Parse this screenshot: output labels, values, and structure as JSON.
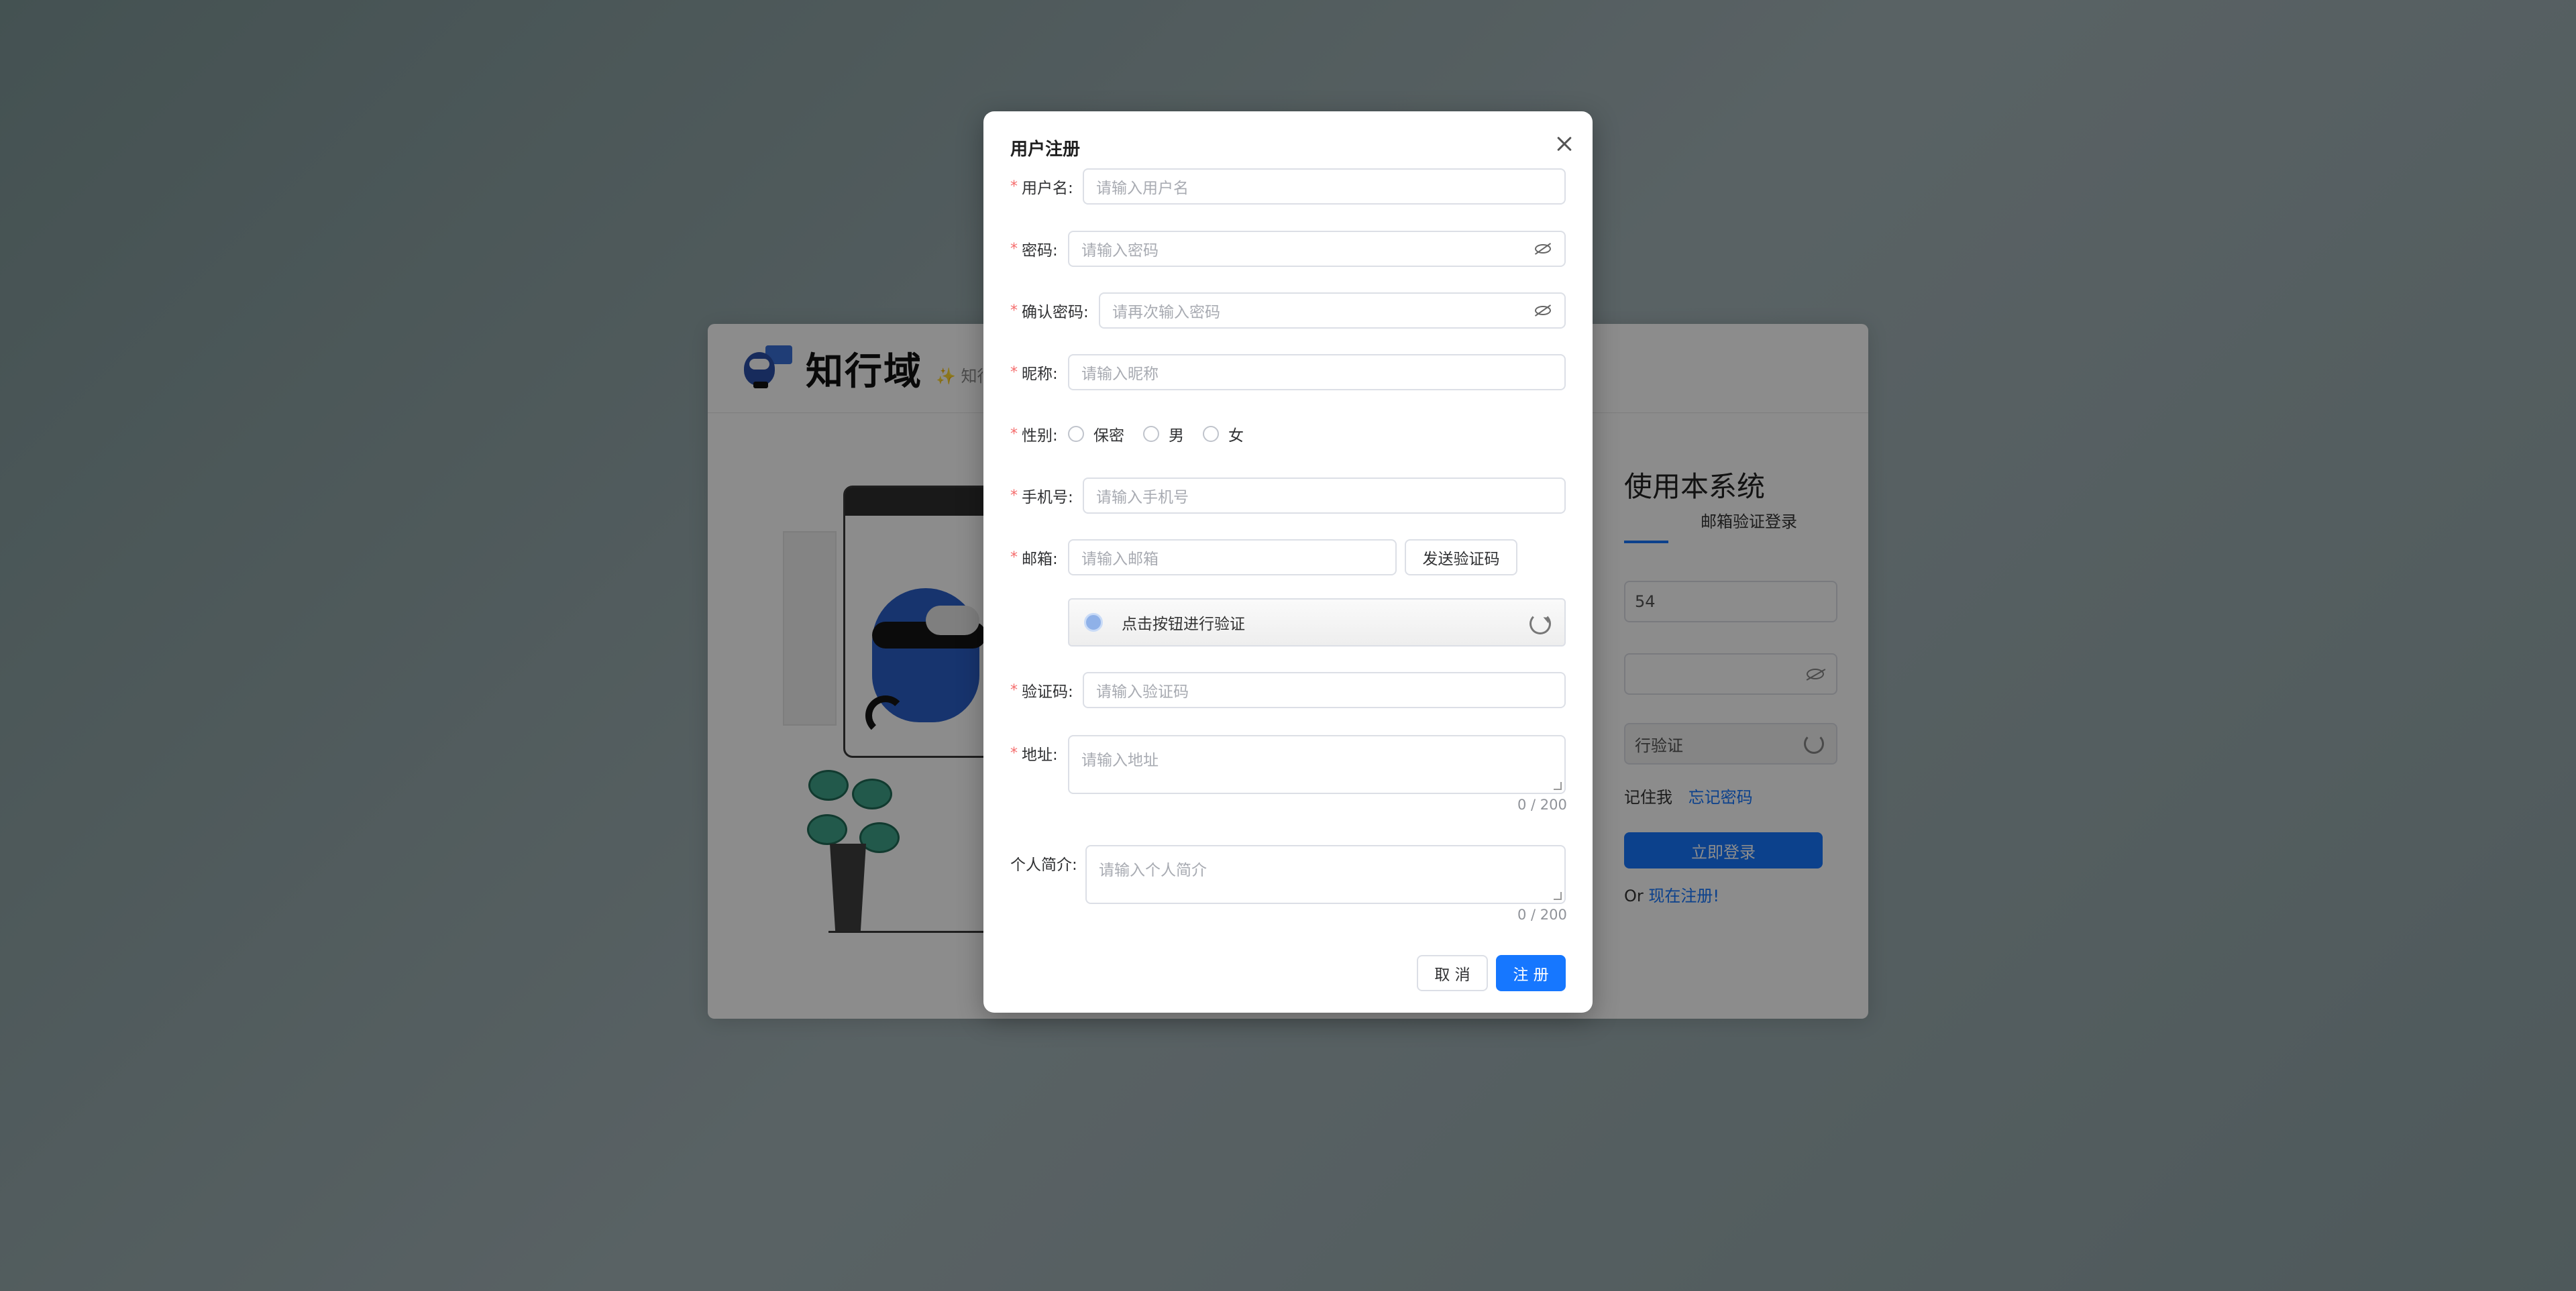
{
  "background": {
    "brand": {
      "title": "知行域",
      "subtitle": "✨ 知行"
    },
    "login": {
      "welcome": "使用本系统",
      "tab_email": "邮箱验证登录",
      "username_value": "54",
      "captcha_text": "行验证",
      "remember": "记住我",
      "forgot": "忘记密码",
      "login_button": "立即登录",
      "or_text": "Or ",
      "register_link": "现在注册!"
    }
  },
  "modal": {
    "title": "用户注册",
    "fields": {
      "username": {
        "label": "用户名:",
        "placeholder": "请输入用户名"
      },
      "password": {
        "label": "密码:",
        "placeholder": "请输入密码"
      },
      "confirm": {
        "label": "确认密码:",
        "placeholder": "请再次输入密码"
      },
      "nickname": {
        "label": "昵称:",
        "placeholder": "请输入昵称"
      },
      "gender": {
        "label": "性别:",
        "options": [
          "保密",
          "男",
          "女"
        ]
      },
      "phone": {
        "label": "手机号:",
        "placeholder": "请输入手机号"
      },
      "email": {
        "label": "邮箱:",
        "placeholder": "请输入邮箱",
        "send_button": "发送验证码"
      },
      "captcha_slider": {
        "text": "点击按钮进行验证"
      },
      "code": {
        "label": "验证码:",
        "placeholder": "请输入验证码"
      },
      "address": {
        "label": "地址:",
        "placeholder": "请输入地址",
        "counter": "0 / 200"
      },
      "bio": {
        "label": "个人简介:",
        "placeholder": "请输入个人简介",
        "counter": "0 / 200"
      }
    },
    "buttons": {
      "cancel": "取 消",
      "submit": "注 册"
    }
  },
  "colors": {
    "primary": "#1677ff",
    "required": "#f56c6c",
    "mask": "rgba(0,0,0,0.45)"
  }
}
